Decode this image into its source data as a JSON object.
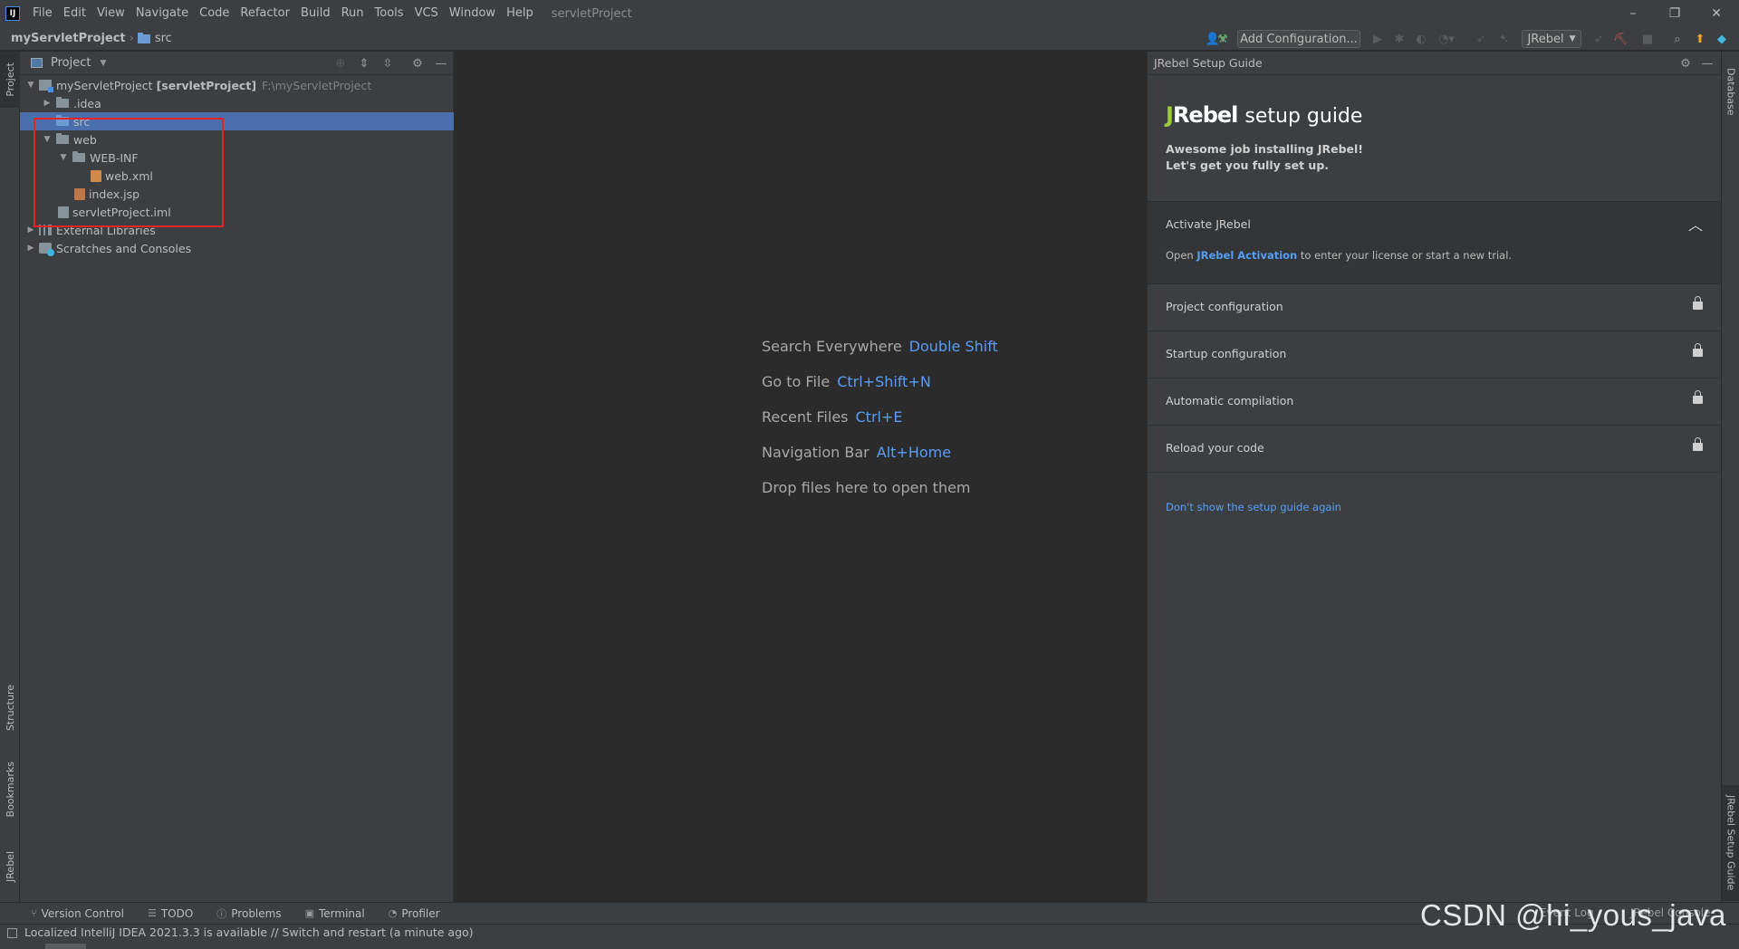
{
  "menu": {
    "items": [
      "File",
      "Edit",
      "View",
      "Navigate",
      "Code",
      "Refactor",
      "Build",
      "Run",
      "Tools",
      "VCS",
      "Window",
      "Help"
    ],
    "project_title": "servletProject"
  },
  "window_controls": {
    "minimize": "–",
    "restore": "❐",
    "close": "✕"
  },
  "navbar": {
    "project": "myServletProject",
    "folder": "src",
    "add_configuration": "Add Configuration...",
    "jrebel_select": "JRebel"
  },
  "left_stripe": {
    "project": "Project",
    "structure": "Structure",
    "bookmarks": "Bookmarks",
    "jrebel": "JRebel"
  },
  "project_panel": {
    "title": "Project",
    "root": {
      "name": "myServletProject",
      "module": "[servletProject]",
      "path": "F:\\myServletProject"
    },
    "tree": [
      {
        "label": ".idea"
      },
      {
        "label": "src"
      },
      {
        "label": "web"
      },
      {
        "label": "WEB-INF"
      },
      {
        "label": "web.xml"
      },
      {
        "label": "index.jsp"
      },
      {
        "label": "servletProject.iml"
      },
      {
        "label": "External Libraries"
      },
      {
        "label": "Scratches and Consoles"
      }
    ]
  },
  "editor": {
    "hints": [
      {
        "label": "Search Everywhere",
        "key": "Double Shift"
      },
      {
        "label": "Go to File",
        "key": "Ctrl+Shift+N"
      },
      {
        "label": "Recent Files",
        "key": "Ctrl+E"
      },
      {
        "label": "Navigation Bar",
        "key": "Alt+Home"
      },
      {
        "label": "Drop files here to open them",
        "key": ""
      }
    ]
  },
  "jrebel": {
    "header": "JRebel Setup Guide",
    "logo_j": "J",
    "logo_rest": "Rebel",
    "logo_text": "setup guide",
    "intro_line1": "Awesome job installing JRebel!",
    "intro_line2": "Let's get you fully set up.",
    "activate_title": "Activate JRebel",
    "activate_open": "Open",
    "activate_link": "JRebel Activation",
    "activate_rest": "to enter your license or start a new trial.",
    "sections": [
      "Project configuration",
      "Startup configuration",
      "Automatic compilation",
      "Reload your code"
    ],
    "dont_show": "Don't show the setup guide again"
  },
  "right_stripe": {
    "database": "Database",
    "setup_guide": "JRebel Setup Guide"
  },
  "bottom_bar": {
    "items": [
      "Version Control",
      "TODO",
      "Problems",
      "Terminal",
      "Profiler"
    ],
    "event_log": "Event Log",
    "jrebel_console": "JRebel Console"
  },
  "status": {
    "message": "Localized IntelliJ IDEA 2021.3.3 is available // Switch and restart (a minute ago)"
  },
  "watermark": "CSDN @hi_yous_java",
  "colors": {
    "accent_link": "#589df6",
    "selection": "#4b6eaf",
    "highlight_box": "#e52525",
    "jrebel_green": "#9ccc3c"
  }
}
